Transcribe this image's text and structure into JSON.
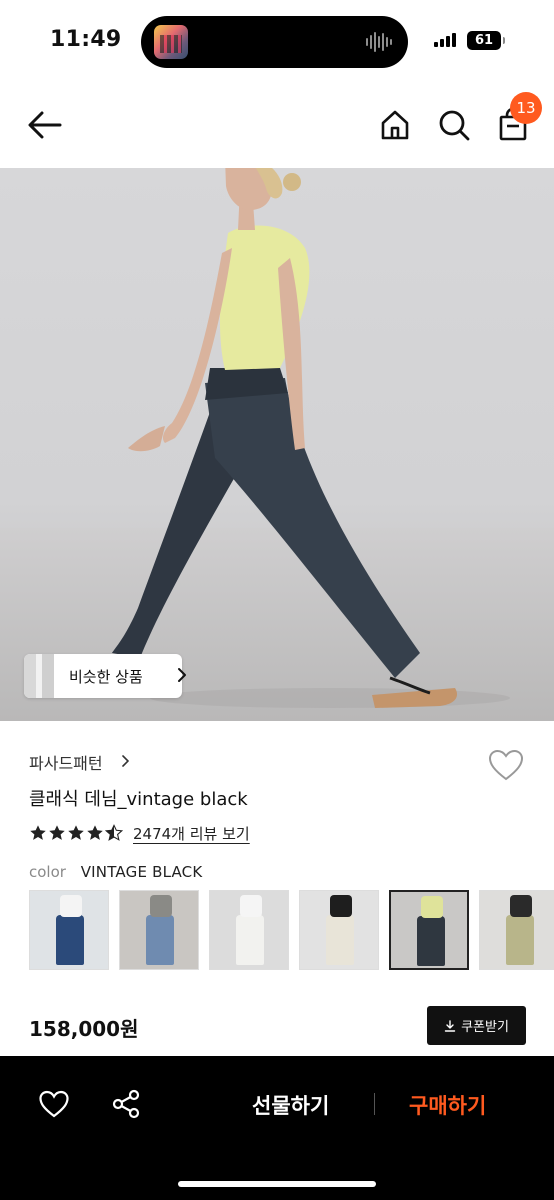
{
  "status_bar": {
    "time": "11:49",
    "battery": "61",
    "icons": [
      "now-playing-thumbnail",
      "audio-waveform-icon",
      "signal-bars-icon",
      "battery-icon"
    ]
  },
  "header": {
    "cart_count": "13",
    "icons": [
      "back-arrow-icon",
      "home-icon",
      "search-icon",
      "shopping-bag-icon"
    ]
  },
  "hero": {
    "similar_label": "비슷한 상품"
  },
  "product": {
    "brand": "파사드패턴",
    "name": "클래식 데님_vintage black",
    "rating_stars": 4.5,
    "review_link": "2474개 리뷰 보기",
    "color_label": "color",
    "color_value": "VINTAGE BLACK",
    "color_options": [
      {
        "name": "dark-blue",
        "top": "#f4f4f4",
        "bottom": "#2b4a7a",
        "bg": "#dfe3e6"
      },
      {
        "name": "light-blue",
        "top": "#8a8a86",
        "bottom": "#6f8bb0",
        "bg": "#c9c6c2"
      },
      {
        "name": "white",
        "top": "#f5f5f5",
        "bottom": "#f2f2ef",
        "bg": "#dcdcdc"
      },
      {
        "name": "beige",
        "top": "#1e1e1e",
        "bottom": "#e8e4d8",
        "bg": "#e2e2e2"
      },
      {
        "name": "vintage-black",
        "top": "#dfe39a",
        "bottom": "#2f3740",
        "bg": "#c9c8c6",
        "selected": true
      },
      {
        "name": "olive",
        "top": "#2a2a2a",
        "bottom": "#b8b58a",
        "bg": "#dedddb"
      }
    ],
    "price": "158,000원",
    "coupon_label": "쿠폰받기"
  },
  "bottom_bar": {
    "gift_label": "선물하기",
    "buy_label": "구매하기",
    "accent": "#ff5a1f"
  }
}
